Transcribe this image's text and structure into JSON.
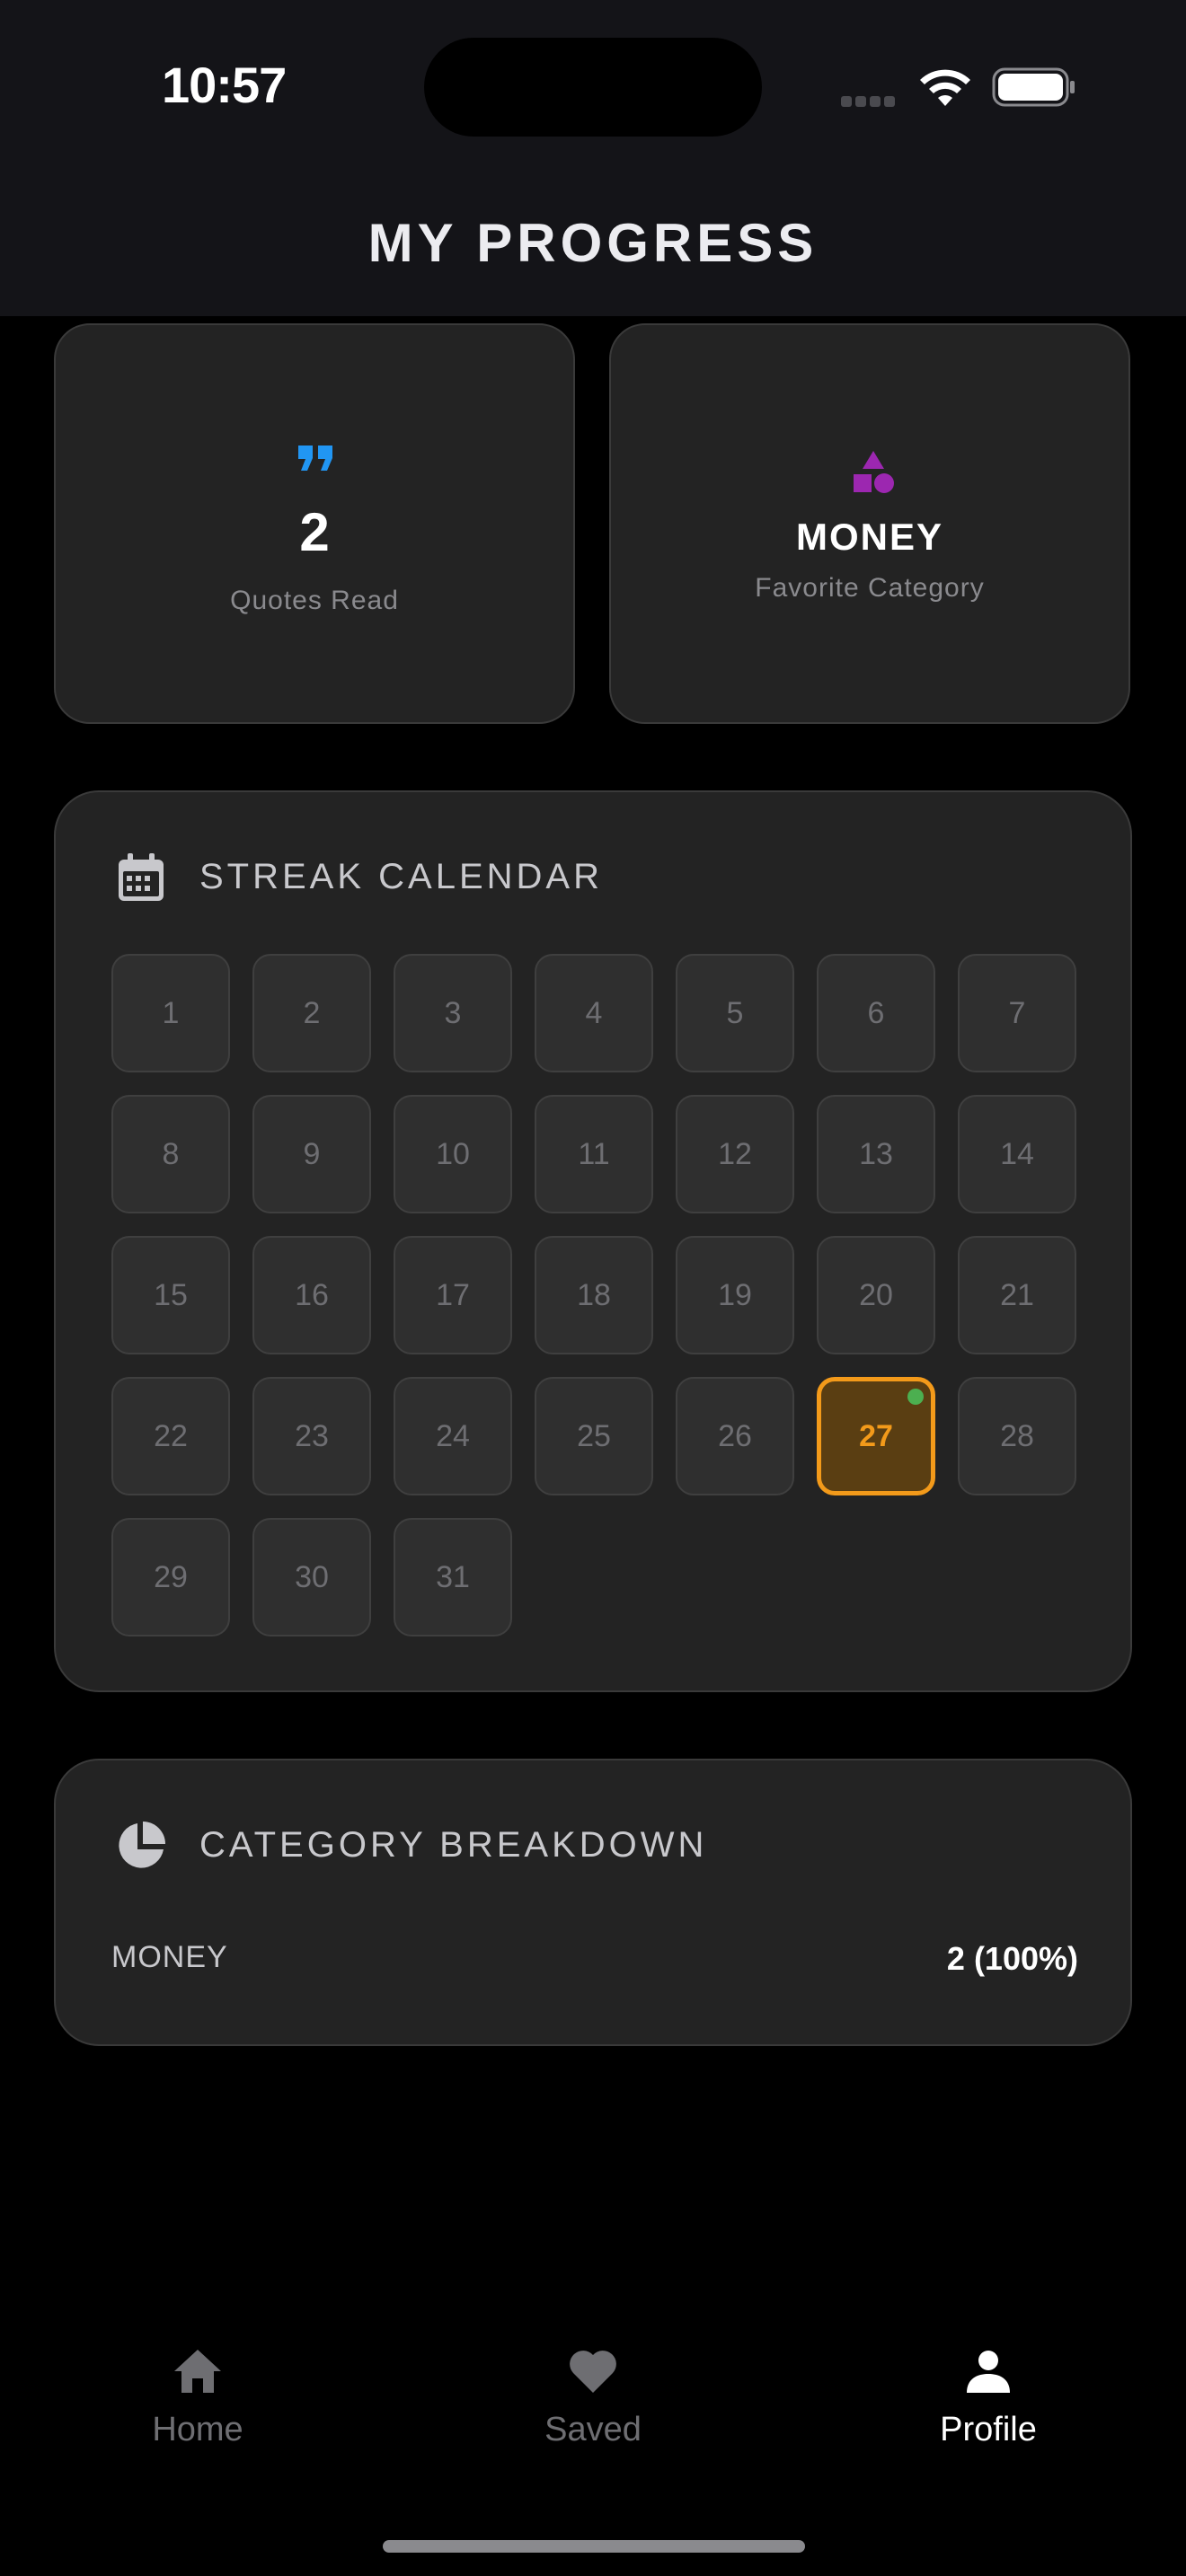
{
  "status_bar": {
    "time": "10:57"
  },
  "header": {
    "title": "MY PROGRESS"
  },
  "stats": {
    "quotes_read": {
      "value": "2",
      "label": "Quotes Read",
      "icon": "quote-icon",
      "icon_color": "#2196f3"
    },
    "favorite_category": {
      "value": "MONEY",
      "label": "Favorite Category",
      "icon": "shapes-icon",
      "icon_color": "#9c27b0"
    }
  },
  "calendar": {
    "title": "STREAK CALENDAR",
    "icon": "calendar-icon",
    "days": [
      "1",
      "2",
      "3",
      "4",
      "5",
      "6",
      "7",
      "8",
      "9",
      "10",
      "11",
      "12",
      "13",
      "14",
      "15",
      "16",
      "17",
      "18",
      "19",
      "20",
      "21",
      "22",
      "23",
      "24",
      "25",
      "26",
      "27",
      "28",
      "29",
      "30",
      "31"
    ],
    "today": "27",
    "today_color": "#f39a1a",
    "read_dot_color": "#4caf50"
  },
  "breakdown": {
    "title": "CATEGORY BREAKDOWN",
    "icon": "pie-chart-icon",
    "rows": [
      {
        "category": "MONEY",
        "count": "2 (100%)"
      }
    ]
  },
  "tab_bar": {
    "tabs": [
      {
        "label": "Home",
        "icon": "home-icon",
        "active": false
      },
      {
        "label": "Saved",
        "icon": "heart-icon",
        "active": false
      },
      {
        "label": "Profile",
        "icon": "person-icon",
        "active": true
      }
    ]
  }
}
